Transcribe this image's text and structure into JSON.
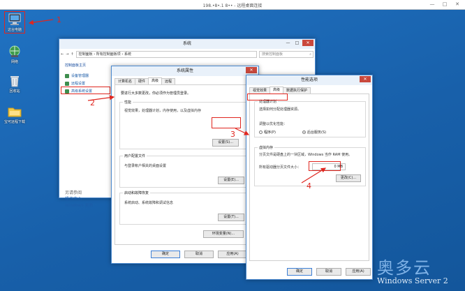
{
  "rdp": {
    "title": "198.•8•.1 8•• - 远程桌面连接",
    "min": "—",
    "max": "□",
    "close": "✕"
  },
  "desktop": {
    "icons": [
      {
        "label": "这台电脑",
        "icon": "computer-icon"
      },
      {
        "label": "网络",
        "icon": "network-icon"
      },
      {
        "label": "回收站",
        "icon": "recycle-bin-icon"
      },
      {
        "label": "宝可远程下载",
        "icon": "folder-icon"
      }
    ]
  },
  "callouts": [
    "1",
    "2",
    "3",
    "4"
  ],
  "system_window": {
    "title": "系统",
    "address": "控制面板 › 所有控制面板项 › 系统",
    "search_placeholder": "搜索控制面板",
    "side_home": "控制面板主页",
    "side_links": [
      "设备管理器",
      "远程设置",
      "高级系统设置"
    ],
    "see_also": "另请参阅",
    "bottom_links": [
      "操作中心",
      "Windows 更新"
    ]
  },
  "sysprops": {
    "title": "系统属性",
    "tabs": [
      "计算机名",
      "硬件",
      "高级",
      "远程"
    ],
    "note": "要进行大多数更改，你必须作为管理员登录。",
    "perf_title": "性能",
    "perf_text": "视觉效果，处理器计划，内存使用，以及虚拟内存",
    "profiles_title": "用户配置文件",
    "profiles_text": "与登录帐户相关的桌面设置",
    "startup_title": "启动和故障恢复",
    "startup_text": "系统启动、系统故障和调试信息",
    "settings": "设置(S)...",
    "settings2": "设置(E)...",
    "settings3": "设置(T)...",
    "env_vars": "环境变量(N)...",
    "ok": "确定",
    "cancel": "取消",
    "apply": "应用(A)"
  },
  "perfopts": {
    "title": "性能选项",
    "tabs": [
      "视觉效果",
      "高级",
      "数据执行保护"
    ],
    "sched_title": "处理器计划",
    "sched_text": "选择如何分配处理器资源。",
    "adjust_label": "调整以优化性能：",
    "radio_programs": "程序(P)",
    "radio_background": "后台服务(S)",
    "vm_title": "虚拟内存",
    "vm_text": "分页文件是硬盘上的一块区域，Windows 当作 RAM 使用。",
    "vm_size_label": "所有驱动器分页文件大小：",
    "vm_size_value": "0 MB",
    "change": "更改(C)...",
    "ok": "确定",
    "cancel": "取消",
    "apply": "应用(A)"
  },
  "watermark": {
    "brand": "奥多云",
    "sub": "Windows Server 2"
  }
}
